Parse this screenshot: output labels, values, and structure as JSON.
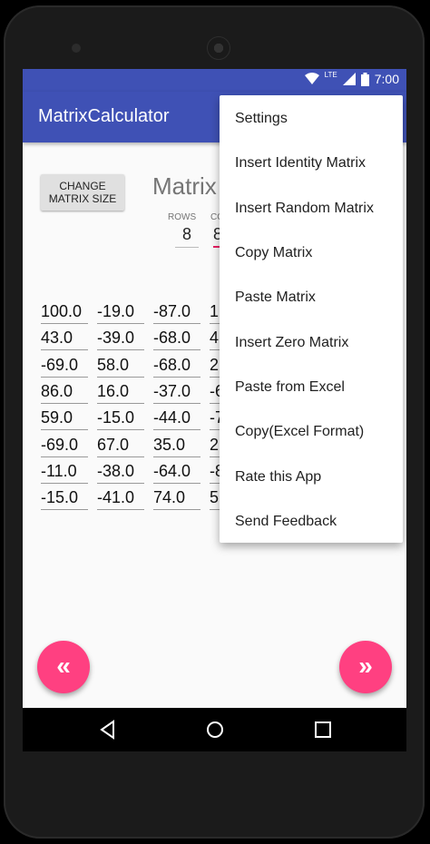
{
  "status": {
    "time": "7:00",
    "network": "LTE"
  },
  "app": {
    "title": "MatrixCalculator"
  },
  "controls": {
    "change_size_label_1": "CHANGE",
    "change_size_label_2": "MATRIX SIZE",
    "matrix_label": "Matrix",
    "rows_label": "ROWS",
    "cols_label": "CO",
    "rows_value": "8",
    "cols_value": "8"
  },
  "matrix": [
    [
      "100.0",
      "-19.0",
      "-87.0",
      "1"
    ],
    [
      "43.0",
      "-39.0",
      "-68.0",
      "4"
    ],
    [
      "-69.0",
      "58.0",
      "-68.0",
      "2"
    ],
    [
      "86.0",
      "16.0",
      "-37.0",
      "-6"
    ],
    [
      "59.0",
      "-15.0",
      "-44.0",
      "-7"
    ],
    [
      "-69.0",
      "67.0",
      "35.0",
      "2"
    ],
    [
      "-11.0",
      "-38.0",
      "-64.0",
      "-8"
    ],
    [
      "-15.0",
      "-41.0",
      "74.0",
      "5"
    ]
  ],
  "menu": {
    "items": [
      "Settings",
      "Insert Identity Matrix",
      "Insert Random Matrix",
      "Copy Matrix",
      "Paste Matrix",
      "Insert Zero Matrix",
      "Paste from Excel",
      "Copy(Excel Format)",
      "Rate this App",
      "Send Feedback"
    ]
  },
  "fab": {
    "prev_glyph": "«",
    "next_glyph": "»"
  },
  "colors": {
    "primary": "#3f51b5",
    "accent": "#ff4081"
  }
}
